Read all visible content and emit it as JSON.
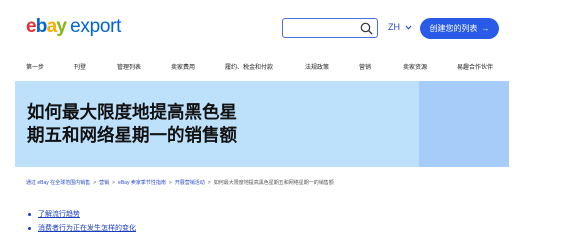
{
  "logo": {
    "ebay": [
      "e",
      "b",
      "a",
      "y"
    ],
    "suffix": "export"
  },
  "header": {
    "search_placeholder": "",
    "language": "ZH",
    "cta_label": "创建您的列表",
    "cta_arrow": "→"
  },
  "nav": {
    "items": [
      "第一步",
      "刊登",
      "管理列表",
      "卖家费用",
      "履约、税金和付款",
      "法规政策",
      "营销",
      "卖家资源",
      "易趣合作伙伴"
    ]
  },
  "hero": {
    "title_line1": "如何最大限度地提高黑色星",
    "title_line2": "期五和网络星期一的销售额"
  },
  "breadcrumb": {
    "items": [
      "通过 eBay 在全球范围内销售",
      "营销",
      "eBay 卖家季节性指南",
      "开展营销活动"
    ],
    "separator": ">",
    "current": "如何最大限度地提高黑色星期五和网络星期一的销售额"
  },
  "toc": {
    "items": [
      "了解流行趋势",
      "消费者行为正在发生怎样的变化"
    ]
  },
  "colors": {
    "accent": "#2a5ae8",
    "hero_bg": "#bde0fb",
    "hero_accent": "#a6cdfa",
    "link": "#1a3ec0"
  }
}
